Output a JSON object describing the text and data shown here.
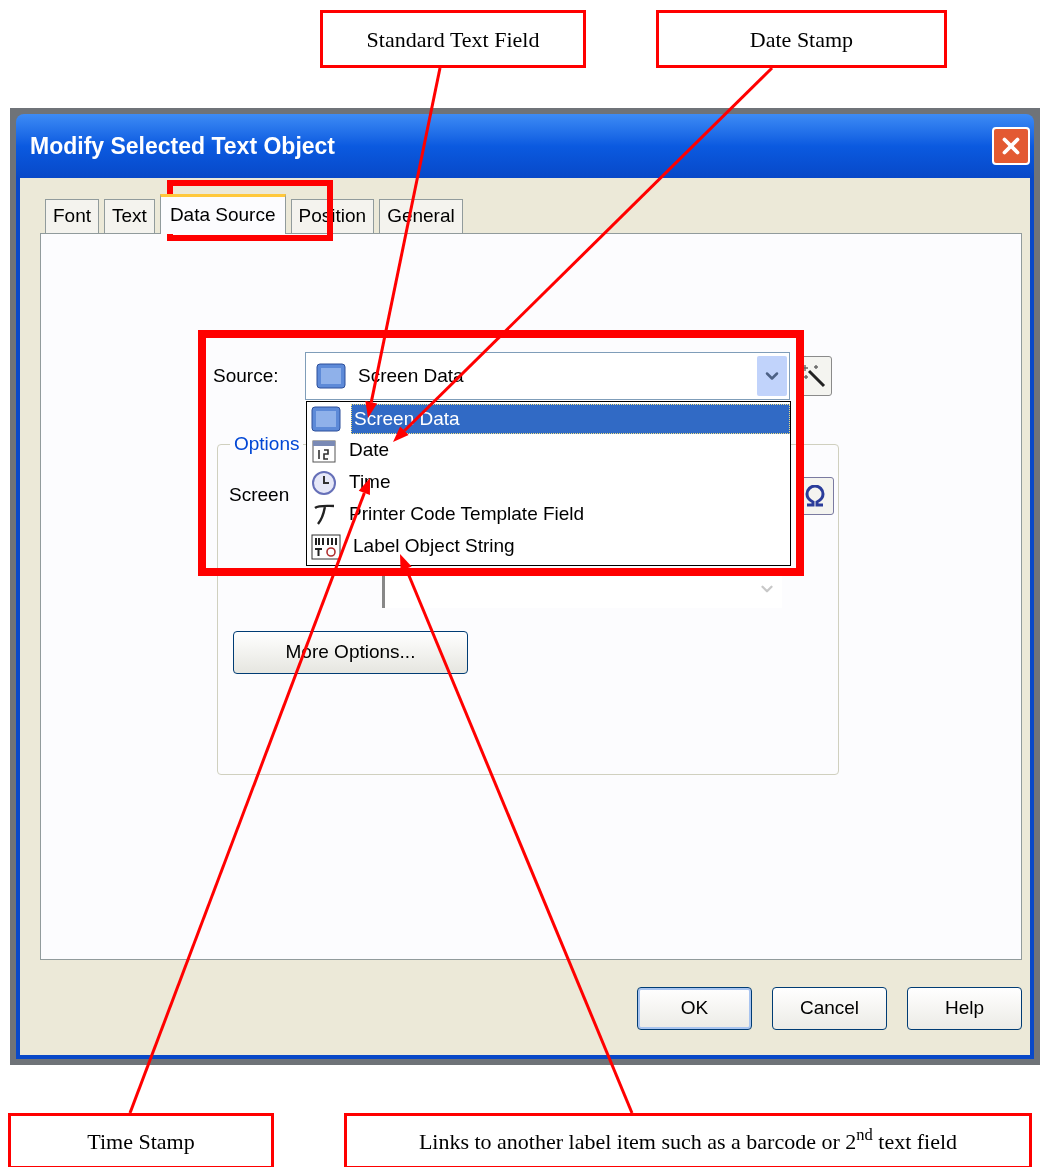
{
  "callouts_top": [
    "Standard Text Field",
    "Date Stamp"
  ],
  "dialog": {
    "title": "Modify Selected Text Object",
    "tabs": [
      {
        "label": "Font",
        "selected": false
      },
      {
        "label": "Text",
        "selected": false
      },
      {
        "label": "Data Source",
        "selected": true
      },
      {
        "label": "Position",
        "selected": false
      },
      {
        "label": "General",
        "selected": false
      }
    ],
    "source": {
      "label": "Source:",
      "value": "Screen Data",
      "expanded": true,
      "options": [
        {
          "label": "Screen Data",
          "kind": "screen",
          "selected": true
        },
        {
          "label": "Date",
          "kind": "calendar",
          "selected": false
        },
        {
          "label": "Time",
          "kind": "clock",
          "selected": false
        },
        {
          "label": "Printer Code Template Field",
          "kind": "template",
          "selected": false
        },
        {
          "label": "Label Object String",
          "kind": "label",
          "selected": false
        }
      ]
    },
    "options_group": {
      "legend": "Options",
      "field_label": "Screen",
      "more_button": "More Options..."
    },
    "buttons": [
      "OK",
      "Cancel",
      "Help"
    ]
  },
  "callouts_bottom": [
    "Time Stamp",
    "Links to another label item such as a barcode or 2$^{nd}$ text field"
  ]
}
